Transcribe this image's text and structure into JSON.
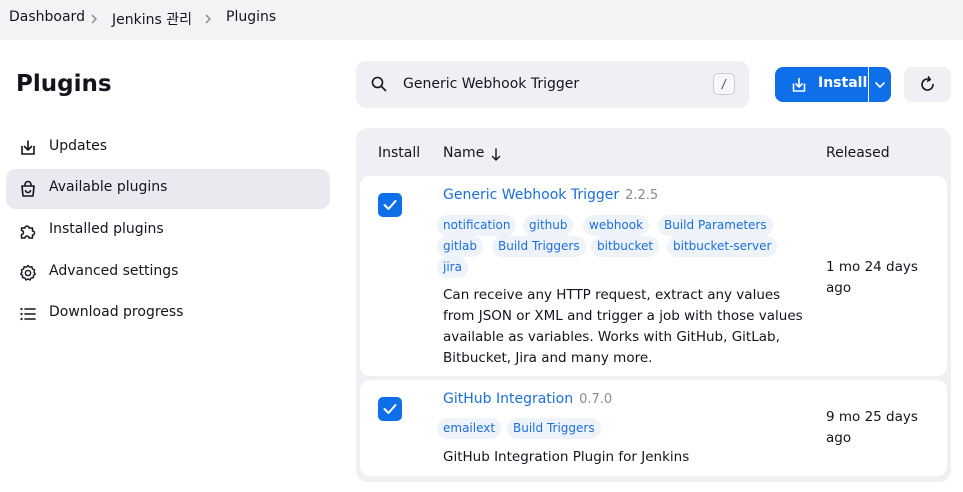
{
  "breadcrumb": {
    "items": [
      "Dashboard",
      "Jenkins 관리",
      "Plugins"
    ]
  },
  "page": {
    "title": "Plugins"
  },
  "sidebar": {
    "items": [
      {
        "label": "Updates",
        "icon": "download-icon",
        "active": false
      },
      {
        "label": "Available plugins",
        "icon": "shopping-bag-icon",
        "active": true
      },
      {
        "label": "Installed plugins",
        "icon": "puzzle-icon",
        "active": false
      },
      {
        "label": "Advanced settings",
        "icon": "gear-icon",
        "active": false
      },
      {
        "label": "Download progress",
        "icon": "list-icon",
        "active": false
      }
    ]
  },
  "search": {
    "value": "Generic Webhook Trigger",
    "shortcut": "/"
  },
  "toolbar": {
    "install_label": "Install"
  },
  "table": {
    "headers": {
      "install": "Install",
      "name": "Name",
      "released": "Released"
    },
    "rows": [
      {
        "checked": true,
        "name": "Generic Webhook Trigger",
        "version": "2.2.5",
        "tags": [
          "notification",
          "github",
          "webhook",
          "Build Parameters",
          "gitlab",
          "Build Triggers",
          "bitbucket",
          "bitbucket-server",
          "jira"
        ],
        "description": "Can receive any HTTP request, extract any values from JSON or XML and trigger a job with those values available as variables. Works with GitHub, GitLab, Bitbucket, Jira and many more.",
        "released": "1 mo 24 days ago"
      },
      {
        "checked": true,
        "name": "GitHub Integration",
        "version": "0.7.0",
        "tags": [
          "emailext",
          "Build Triggers"
        ],
        "description": "GitHub Integration Plugin for Jenkins",
        "released": "9 mo 25 days ago"
      }
    ]
  },
  "colors": {
    "accent": "#0f6fe8",
    "link": "#1a6fdb",
    "active_bg": "#e9eaf0",
    "panel_bg": "#f0f0f4"
  }
}
